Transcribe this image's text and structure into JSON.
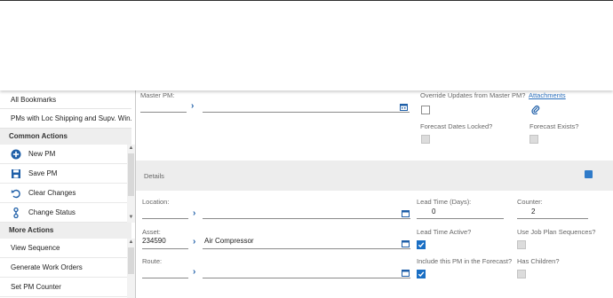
{
  "left_panel": {
    "bookmarks": [
      "All Bookmarks",
      "PMs with Loc Shipping and Supv. Win..."
    ],
    "common_actions_header": "Common Actions",
    "common_actions": [
      {
        "label": "New PM",
        "icon": "plus-circle-icon"
      },
      {
        "label": "Save PM",
        "icon": "save-icon"
      },
      {
        "label": "Clear Changes",
        "icon": "undo-icon"
      },
      {
        "label": "Change Status",
        "icon": "status-icon"
      }
    ],
    "more_actions_header": "More Actions",
    "more_actions": [
      "View Sequence",
      "Generate Work Orders",
      "Set PM Counter"
    ]
  },
  "form": {
    "master_pm_label": "Master PM:",
    "override_label": "Override Updates from Master PM?",
    "attachments_label": "Attachments",
    "forecast_locked_label": "Forecast Dates Locked?",
    "forecast_exists_label": "Forecast Exists?",
    "details_title": "Details",
    "location_label": "Location:",
    "lead_time_label": "Lead Time (Days):",
    "lead_time_value": "0",
    "counter_label": "Counter:",
    "counter_value": "2",
    "asset_label": "Asset:",
    "asset_value": "234590",
    "asset_desc": "Air Compressor",
    "lead_time_active_label": "Lead Time Active?",
    "use_job_plan_label": "Use Job Plan Sequences?",
    "route_label": "Route:",
    "include_forecast_label": "Include this PM in the Forecast?",
    "has_children_label": "Has Children?"
  },
  "colors": {
    "accent": "#1a6fc4",
    "link": "#2a6ebb",
    "section_bg": "#ededed"
  }
}
